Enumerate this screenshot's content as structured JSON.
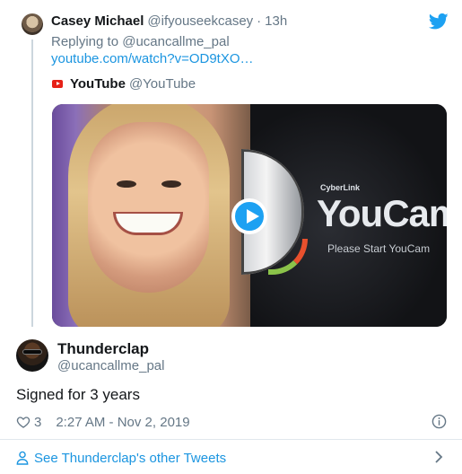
{
  "parent_tweet": {
    "name": "Casey Michael",
    "handle": "@ifyouseekcasey",
    "separator": "·",
    "time": "13h",
    "replying_to": "Replying to @ucancallme_pal",
    "link": "youtube.com/watch?v=OD9tXO…",
    "source": {
      "name": "YouTube",
      "handle": "@YouTube"
    },
    "video": {
      "brand_small": "CyberLink",
      "brand_large": "YouCam",
      "caption": "Please Start YouCam"
    }
  },
  "tweet": {
    "name": "Thunderclap",
    "handle": "@ucancallme_pal",
    "text": "Signed for 3 years",
    "likes": "3",
    "timestamp": "2:27 AM - Nov 2, 2019"
  },
  "footer": {
    "label": "See Thunderclap's other Tweets"
  },
  "colors": {
    "twitter_blue": "#1DA1F2",
    "link_blue": "#1B95E0",
    "secondary_text": "#657786",
    "youtube_red": "#E62117"
  },
  "icons": [
    "twitter-bird-icon",
    "youtube-logo-icon",
    "play-icon",
    "heart-icon",
    "info-icon",
    "person-icon",
    "chevron-right-icon"
  ]
}
